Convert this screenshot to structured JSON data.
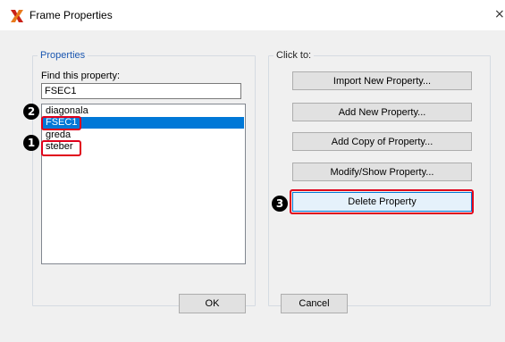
{
  "window": {
    "title": "Frame Properties",
    "close_glyph": "×",
    "icon": "app-x-icon"
  },
  "properties_group": {
    "label": "Properties",
    "find_label": "Find this property:",
    "find_value": "FSEC1",
    "items": [
      {
        "label": "diagonala",
        "selected": false
      },
      {
        "label": "FSEC1",
        "selected": true
      },
      {
        "label": "greda",
        "selected": false
      },
      {
        "label": "steber",
        "selected": false
      }
    ]
  },
  "click_group": {
    "label": "Click to:",
    "buttons": [
      "Import New Property...",
      "Add New Property...",
      "Add Copy of Property...",
      "Modify/Show Property...",
      "Delete Property"
    ]
  },
  "footer": {
    "ok_label": "OK",
    "cancel_label": "Cancel"
  },
  "annotations": {
    "markers": [
      "1",
      "2",
      "3"
    ],
    "highlight_color": "#e0001b"
  },
  "colors": {
    "selection": "#0078d7",
    "group_label_accent": "#1a56b0"
  }
}
